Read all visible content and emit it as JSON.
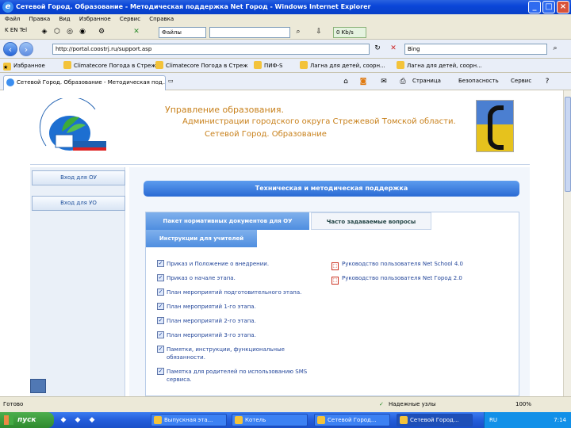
{
  "window": {
    "title": "Сетевой Город. Образование - Методическая поддержка Net Город - Windows Internet Explorer"
  },
  "menu": [
    "Файл",
    "Правка",
    "Вид",
    "Избранное",
    "Сервис",
    "Справка"
  ],
  "toolbar1": {
    "left_label": "K EN Tel",
    "files_label": "Файлы",
    "progress_label": "0 Kb/s"
  },
  "address": {
    "url": "http://portal.coostrj.ru/support.asp",
    "search_text": "Bing"
  },
  "favorites_bar": {
    "label": "Избранное",
    "items": [
      "Climatecore Погода в Стреж",
      "Climatecore Погода в Стреж",
      "ПИФ-S",
      "Лагна для детей, соорн...",
      "Лагна для детей, соорн..."
    ]
  },
  "tab": {
    "title": "Сетевой Город. Образование - Методическая под..."
  },
  "commands": [
    "Страница",
    "Безопасность",
    "Сервис"
  ],
  "header": {
    "line1": "Управление образования.",
    "line2": "Администрации городского округа Стрежевой Томской области.",
    "line3": "Сетевой Город. Образование",
    "logo_arc_text": "УПРАВЛЕНИЕ ОБРАЗОВАНИЯ",
    "logo_city": "г.Стрежевой"
  },
  "sidebar": {
    "buttons": [
      "Вход для ОУ",
      "Вход для УО"
    ]
  },
  "main": {
    "banner": "Техническая и методическая поддержка",
    "tabs": [
      "Пакет нормативных документов для ОУ",
      "Часто задаваемые вопросы",
      "Инструкции для учителей"
    ],
    "documents": [
      "Приказ и Положение о внедрении.",
      "Приказ о начале этапа.",
      "План мероприятий подготовительного этапа.",
      "План мероприятий 1-го этапа.",
      "План мероприятий 2-го этапа.",
      "План мероприятий 3-го этапа.",
      "Памятки, инструкции, функциональные обязанности.",
      "Памятка для родителей по использованию SMS сервиса."
    ],
    "manuals": [
      "Руководство пользователя Net School 4.0",
      "Руководство пользователя Net Город 2.0"
    ]
  },
  "status": {
    "left": "Готово",
    "zone": "Надежные узлы",
    "zoom": "100%"
  },
  "taskbar": {
    "start_label": "пуск",
    "tasks": [
      "Выпускная эта...",
      "Котель",
      "Сетевой Город...",
      "Сетевой Город..."
    ],
    "lang": "RU",
    "clock": "7:14"
  }
}
